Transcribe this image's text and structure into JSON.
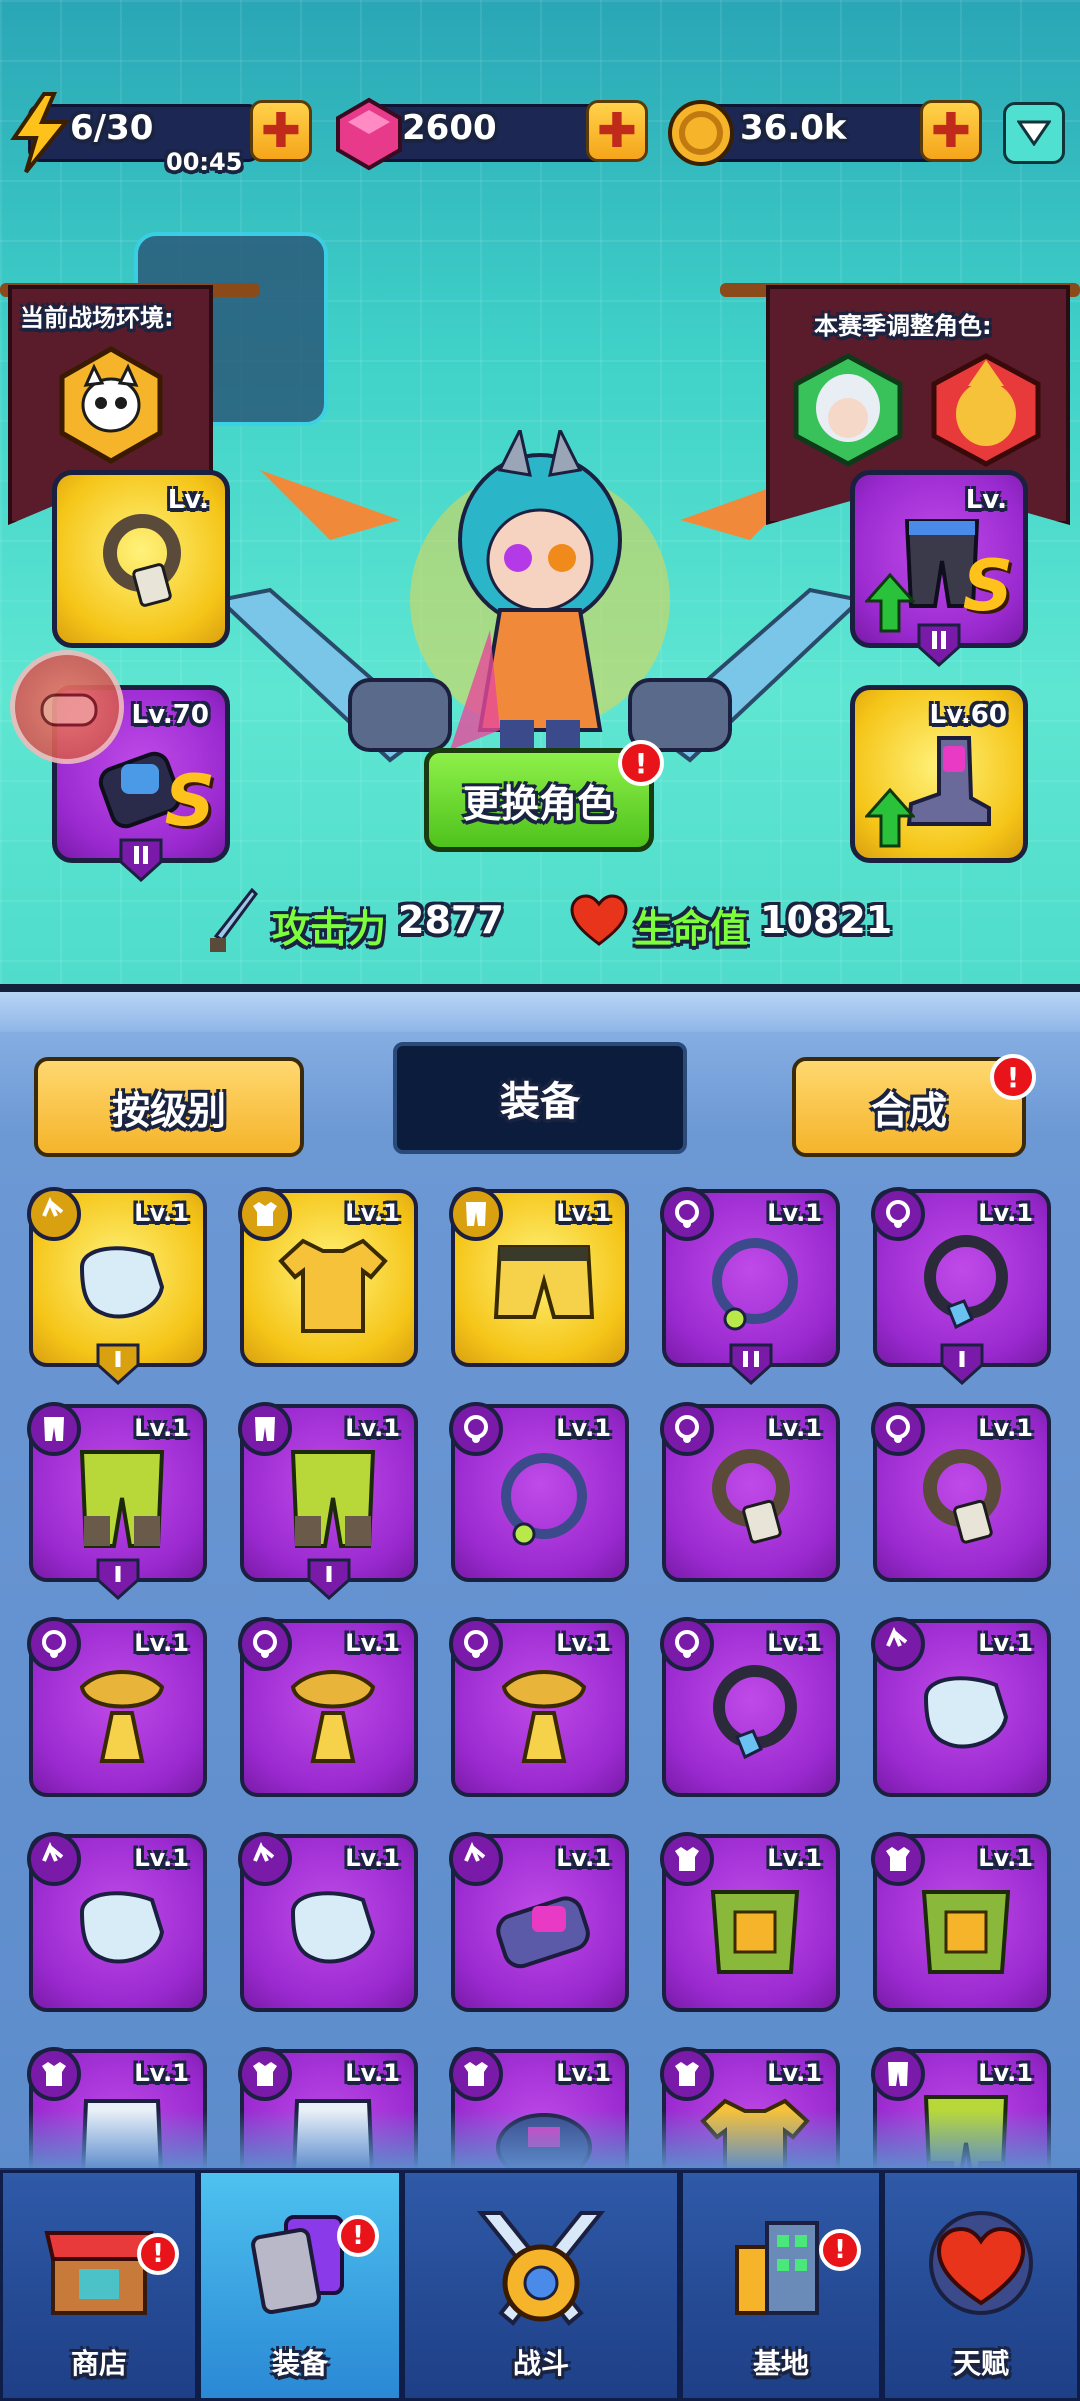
{
  "resources": {
    "energy": "6/30",
    "energy_timer": "00:45",
    "gems": "2600",
    "coins": "36.0k"
  },
  "banners": {
    "left_title": "当前战场环境:",
    "right_title": "本赛季调整角色:"
  },
  "hero_slots": {
    "top_left_lv": "Lv.",
    "bottom_left_lv": "Lv.70",
    "top_right_lv": "Lv.",
    "bottom_right_lv": "Lv.60",
    "s_mark": "S"
  },
  "change_character": "更换角色",
  "alert_mark": "!",
  "stats": {
    "attack_label": "攻击力",
    "attack_value": "2877",
    "hp_label": "生命值",
    "hp_value": "10821"
  },
  "inventory": {
    "sort_button": "按级别",
    "tab_title": "装备",
    "merge_button": "合成",
    "level_label": "Lv.1"
  },
  "nav": {
    "shop": "商店",
    "equipment": "装备",
    "battle": "战斗",
    "base": "基地",
    "talent": "天赋"
  },
  "colors": {
    "gold_rarity": "#f5c518",
    "purple_rarity": "#9a2ad0",
    "alert": "#e8141a",
    "stat_green": "#7cff3a"
  }
}
